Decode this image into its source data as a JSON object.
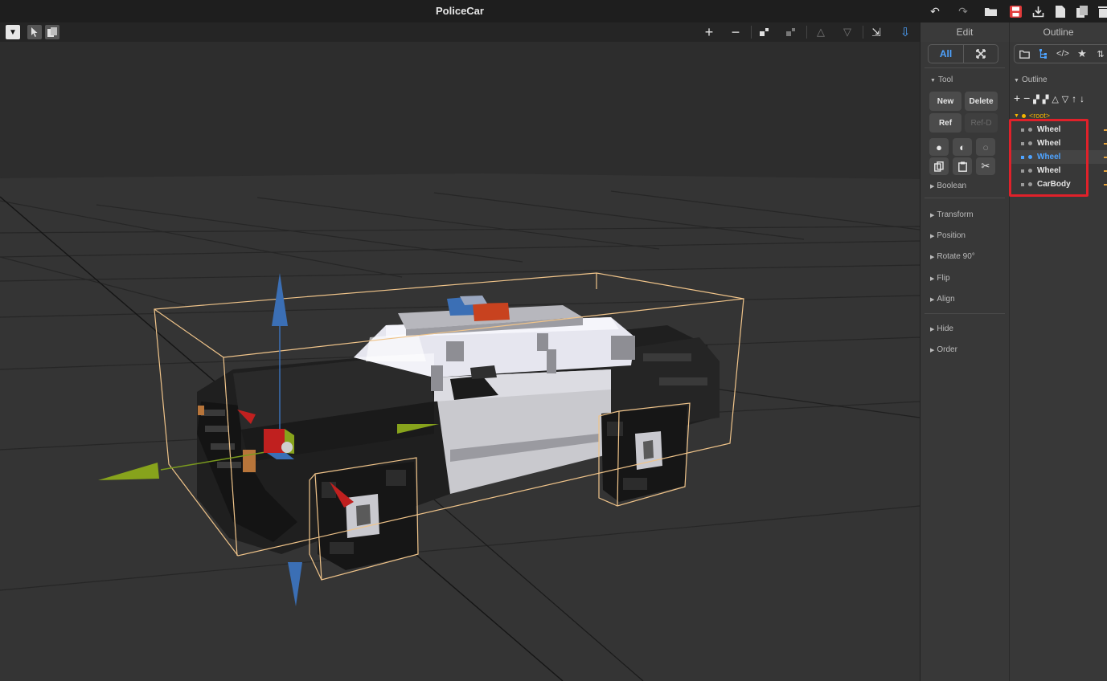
{
  "window": {
    "title": "PoliceCar"
  },
  "titlebar_icons": [
    "undo-icon",
    "redo-icon",
    "open-folder-icon",
    "save-icon",
    "export-icon",
    "file-icon",
    "files-icon",
    "trash-icon"
  ],
  "edit_panel": {
    "header": "Edit",
    "mode": {
      "label": "All",
      "expand_icon": "expand-icon"
    },
    "tool_section": "Tool",
    "buttons": {
      "new": "New",
      "delete": "Delete",
      "ref": "Ref",
      "ref_d": "Ref-D"
    },
    "sections": {
      "boolean": "Boolean",
      "transform": "Transform",
      "position": "Position",
      "rotate": "Rotate 90°",
      "flip": "Flip",
      "align": "Align",
      "hide": "Hide",
      "order": "Order"
    }
  },
  "outline_panel": {
    "header": "Outline",
    "section": "Outline",
    "root_label": "<root>",
    "items": [
      {
        "label": "Wheel",
        "selected": false
      },
      {
        "label": "Wheel",
        "selected": false
      },
      {
        "label": "Wheel",
        "selected": true
      },
      {
        "label": "Wheel",
        "selected": false
      },
      {
        "label": "CarBody",
        "selected": false
      }
    ]
  },
  "colors": {
    "accent": "#4ea3ff",
    "highlight_box": "#e0212a",
    "selection_outline": "#f0c48a",
    "root_label": "#f2b400"
  }
}
